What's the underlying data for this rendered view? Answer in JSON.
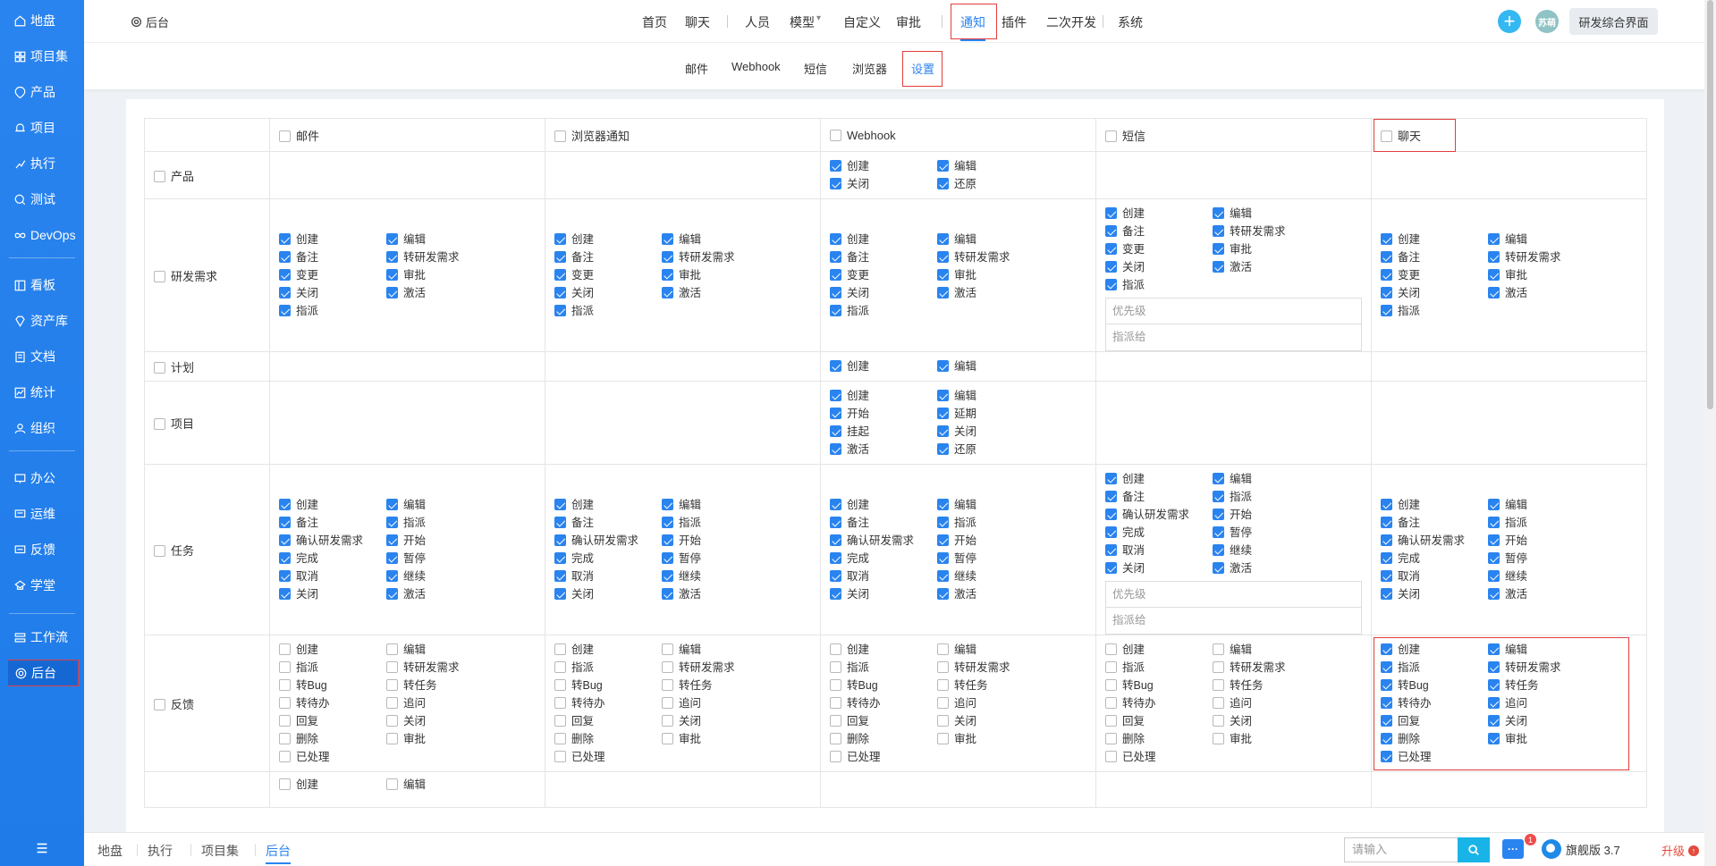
{
  "sidebar": {
    "items": [
      {
        "label": "地盘",
        "icon": "home-icon"
      },
      {
        "label": "项目集",
        "icon": "grid-icon"
      },
      {
        "label": "产品",
        "icon": "product-icon"
      },
      {
        "label": "项目",
        "icon": "bell-icon"
      },
      {
        "label": "执行",
        "icon": "run-icon"
      },
      {
        "label": "测试",
        "icon": "test-icon"
      },
      {
        "label": "DevOps",
        "icon": "infinity-icon"
      },
      {
        "label": "看板",
        "icon": "board-icon"
      },
      {
        "label": "资产库",
        "icon": "gem-icon"
      },
      {
        "label": "文档",
        "icon": "doc-icon"
      },
      {
        "label": "统计",
        "icon": "chart-icon"
      },
      {
        "label": "组织",
        "icon": "people-icon"
      },
      {
        "label": "办公",
        "icon": "office-icon"
      },
      {
        "label": "运维",
        "icon": "server-icon"
      },
      {
        "label": "反馈",
        "icon": "feedback-icon"
      },
      {
        "label": "学堂",
        "icon": "school-icon"
      },
      {
        "label": "工作流",
        "icon": "workflow-icon"
      },
      {
        "label": "后台",
        "icon": "gear-icon"
      }
    ]
  },
  "header": {
    "back_label": "后台",
    "nav": [
      "首页",
      "聊天",
      "人员",
      "模型",
      "自定义",
      "审批",
      "通知",
      "插件",
      "二次开发",
      "系统"
    ],
    "active_nav": "通知",
    "avatar_text": "苏萌",
    "space_label": "研发综合界面"
  },
  "subnav": {
    "items": [
      "邮件",
      "Webhook",
      "短信",
      "浏览器",
      "设置"
    ],
    "active": "设置"
  },
  "table": {
    "columns": [
      "邮件",
      "浏览器通知",
      "Webhook",
      "短信",
      "聊天"
    ],
    "select_placeholders": {
      "priority": "优先级",
      "assign": "指派给"
    },
    "rows": [
      {
        "label": "产品",
        "cells": [
          [],
          [],
          [
            {
              "t": "创建",
              "c": true
            },
            {
              "t": "编辑",
              "c": true
            },
            {
              "t": "关闭",
              "c": true
            },
            {
              "t": "还原",
              "c": true
            }
          ],
          [],
          []
        ]
      },
      {
        "label": "研发需求",
        "cells": [
          [
            {
              "t": "创建",
              "c": true
            },
            {
              "t": "编辑",
              "c": true
            },
            {
              "t": "备注",
              "c": true
            },
            {
              "t": "转研发需求",
              "c": true
            },
            {
              "t": "变更",
              "c": true
            },
            {
              "t": "审批",
              "c": true
            },
            {
              "t": "关闭",
              "c": true
            },
            {
              "t": "激活",
              "c": true
            },
            {
              "t": "指派",
              "c": true
            }
          ],
          [
            {
              "t": "创建",
              "c": true
            },
            {
              "t": "编辑",
              "c": true
            },
            {
              "t": "备注",
              "c": true
            },
            {
              "t": "转研发需求",
              "c": true
            },
            {
              "t": "变更",
              "c": true
            },
            {
              "t": "审批",
              "c": true
            },
            {
              "t": "关闭",
              "c": true
            },
            {
              "t": "激活",
              "c": true
            },
            {
              "t": "指派",
              "c": true
            }
          ],
          [
            {
              "t": "创建",
              "c": true
            },
            {
              "t": "编辑",
              "c": true
            },
            {
              "t": "备注",
              "c": true
            },
            {
              "t": "转研发需求",
              "c": true
            },
            {
              "t": "变更",
              "c": true
            },
            {
              "t": "审批",
              "c": true
            },
            {
              "t": "关闭",
              "c": true
            },
            {
              "t": "激活",
              "c": true
            },
            {
              "t": "指派",
              "c": true
            }
          ],
          [
            {
              "t": "创建",
              "c": true
            },
            {
              "t": "编辑",
              "c": true
            },
            {
              "t": "备注",
              "c": true
            },
            {
              "t": "转研发需求",
              "c": true
            },
            {
              "t": "变更",
              "c": true
            },
            {
              "t": "审批",
              "c": true
            },
            {
              "t": "关闭",
              "c": true
            },
            {
              "t": "激活",
              "c": true
            },
            {
              "t": "指派",
              "c": true
            }
          ],
          [
            {
              "t": "创建",
              "c": true
            },
            {
              "t": "编辑",
              "c": true
            },
            {
              "t": "备注",
              "c": true
            },
            {
              "t": "转研发需求",
              "c": true
            },
            {
              "t": "变更",
              "c": true
            },
            {
              "t": "审批",
              "c": true
            },
            {
              "t": "关闭",
              "c": true
            },
            {
              "t": "激活",
              "c": true
            },
            {
              "t": "指派",
              "c": true
            }
          ]
        ]
      },
      {
        "label": "计划",
        "cells": [
          [],
          [],
          [
            {
              "t": "创建",
              "c": true
            },
            {
              "t": "编辑",
              "c": true
            }
          ],
          [],
          []
        ]
      },
      {
        "label": "项目",
        "cells": [
          [],
          [],
          [
            {
              "t": "创建",
              "c": true
            },
            {
              "t": "编辑",
              "c": true
            },
            {
              "t": "开始",
              "c": true
            },
            {
              "t": "延期",
              "c": true
            },
            {
              "t": "挂起",
              "c": true
            },
            {
              "t": "关闭",
              "c": true
            },
            {
              "t": "激活",
              "c": true
            },
            {
              "t": "还原",
              "c": true
            }
          ],
          [],
          []
        ]
      },
      {
        "label": "任务",
        "cells": [
          [
            {
              "t": "创建",
              "c": true
            },
            {
              "t": "编辑",
              "c": true
            },
            {
              "t": "备注",
              "c": true
            },
            {
              "t": "指派",
              "c": true
            },
            {
              "t": "确认研发需求",
              "c": true
            },
            {
              "t": "开始",
              "c": true
            },
            {
              "t": "完成",
              "c": true
            },
            {
              "t": "暂停",
              "c": true
            },
            {
              "t": "取消",
              "c": true
            },
            {
              "t": "继续",
              "c": true
            },
            {
              "t": "关闭",
              "c": true
            },
            {
              "t": "激活",
              "c": true
            }
          ],
          [
            {
              "t": "创建",
              "c": true
            },
            {
              "t": "编辑",
              "c": true
            },
            {
              "t": "备注",
              "c": true
            },
            {
              "t": "指派",
              "c": true
            },
            {
              "t": "确认研发需求",
              "c": true
            },
            {
              "t": "开始",
              "c": true
            },
            {
              "t": "完成",
              "c": true
            },
            {
              "t": "暂停",
              "c": true
            },
            {
              "t": "取消",
              "c": true
            },
            {
              "t": "继续",
              "c": true
            },
            {
              "t": "关闭",
              "c": true
            },
            {
              "t": "激活",
              "c": true
            }
          ],
          [
            {
              "t": "创建",
              "c": true
            },
            {
              "t": "编辑",
              "c": true
            },
            {
              "t": "备注",
              "c": true
            },
            {
              "t": "指派",
              "c": true
            },
            {
              "t": "确认研发需求",
              "c": true
            },
            {
              "t": "开始",
              "c": true
            },
            {
              "t": "完成",
              "c": true
            },
            {
              "t": "暂停",
              "c": true
            },
            {
              "t": "取消",
              "c": true
            },
            {
              "t": "继续",
              "c": true
            },
            {
              "t": "关闭",
              "c": true
            },
            {
              "t": "激活",
              "c": true
            }
          ],
          [
            {
              "t": "创建",
              "c": true
            },
            {
              "t": "编辑",
              "c": true
            },
            {
              "t": "备注",
              "c": true
            },
            {
              "t": "指派",
              "c": true
            },
            {
              "t": "确认研发需求",
              "c": true
            },
            {
              "t": "开始",
              "c": true
            },
            {
              "t": "完成",
              "c": true
            },
            {
              "t": "暂停",
              "c": true
            },
            {
              "t": "取消",
              "c": true
            },
            {
              "t": "继续",
              "c": true
            },
            {
              "t": "关闭",
              "c": true
            },
            {
              "t": "激活",
              "c": true
            }
          ],
          [
            {
              "t": "创建",
              "c": true
            },
            {
              "t": "编辑",
              "c": true
            },
            {
              "t": "备注",
              "c": true
            },
            {
              "t": "指派",
              "c": true
            },
            {
              "t": "确认研发需求",
              "c": true
            },
            {
              "t": "开始",
              "c": true
            },
            {
              "t": "完成",
              "c": true
            },
            {
              "t": "暂停",
              "c": true
            },
            {
              "t": "取消",
              "c": true
            },
            {
              "t": "继续",
              "c": true
            },
            {
              "t": "关闭",
              "c": true
            },
            {
              "t": "激活",
              "c": true
            }
          ]
        ]
      },
      {
        "label": "反馈",
        "cells": [
          [
            {
              "t": "创建",
              "c": false
            },
            {
              "t": "编辑",
              "c": false
            },
            {
              "t": "指派",
              "c": false
            },
            {
              "t": "转研发需求",
              "c": false
            },
            {
              "t": "转Bug",
              "c": false
            },
            {
              "t": "转任务",
              "c": false
            },
            {
              "t": "转待办",
              "c": false
            },
            {
              "t": "追问",
              "c": false
            },
            {
              "t": "回复",
              "c": false
            },
            {
              "t": "关闭",
              "c": false
            },
            {
              "t": "删除",
              "c": false
            },
            {
              "t": "审批",
              "c": false
            },
            {
              "t": "已处理",
              "c": false
            }
          ],
          [
            {
              "t": "创建",
              "c": false
            },
            {
              "t": "编辑",
              "c": false
            },
            {
              "t": "指派",
              "c": false
            },
            {
              "t": "转研发需求",
              "c": false
            },
            {
              "t": "转Bug",
              "c": false
            },
            {
              "t": "转任务",
              "c": false
            },
            {
              "t": "转待办",
              "c": false
            },
            {
              "t": "追问",
              "c": false
            },
            {
              "t": "回复",
              "c": false
            },
            {
              "t": "关闭",
              "c": false
            },
            {
              "t": "删除",
              "c": false
            },
            {
              "t": "审批",
              "c": false
            },
            {
              "t": "已处理",
              "c": false
            }
          ],
          [
            {
              "t": "创建",
              "c": false
            },
            {
              "t": "编辑",
              "c": false
            },
            {
              "t": "指派",
              "c": false
            },
            {
              "t": "转研发需求",
              "c": false
            },
            {
              "t": "转Bug",
              "c": false
            },
            {
              "t": "转任务",
              "c": false
            },
            {
              "t": "转待办",
              "c": false
            },
            {
              "t": "追问",
              "c": false
            },
            {
              "t": "回复",
              "c": false
            },
            {
              "t": "关闭",
              "c": false
            },
            {
              "t": "删除",
              "c": false
            },
            {
              "t": "审批",
              "c": false
            },
            {
              "t": "已处理",
              "c": false
            }
          ],
          [
            {
              "t": "创建",
              "c": false
            },
            {
              "t": "编辑",
              "c": false
            },
            {
              "t": "指派",
              "c": false
            },
            {
              "t": "转研发需求",
              "c": false
            },
            {
              "t": "转Bug",
              "c": false
            },
            {
              "t": "转任务",
              "c": false
            },
            {
              "t": "转待办",
              "c": false
            },
            {
              "t": "追问",
              "c": false
            },
            {
              "t": "回复",
              "c": false
            },
            {
              "t": "关闭",
              "c": false
            },
            {
              "t": "删除",
              "c": false
            },
            {
              "t": "审批",
              "c": false
            },
            {
              "t": "已处理",
              "c": false
            }
          ],
          [
            {
              "t": "创建",
              "c": true
            },
            {
              "t": "编辑",
              "c": true
            },
            {
              "t": "指派",
              "c": true
            },
            {
              "t": "转研发需求",
              "c": true
            },
            {
              "t": "转Bug",
              "c": true
            },
            {
              "t": "转任务",
              "c": true
            },
            {
              "t": "转待办",
              "c": true
            },
            {
              "t": "追问",
              "c": true
            },
            {
              "t": "回复",
              "c": true
            },
            {
              "t": "关闭",
              "c": true
            },
            {
              "t": "删除",
              "c": true
            },
            {
              "t": "审批",
              "c": true
            },
            {
              "t": "已处理",
              "c": true
            }
          ]
        ]
      },
      {
        "label": "",
        "cells": [
          [
            {
              "t": "创建",
              "c": false
            },
            {
              "t": "编辑",
              "c": false
            }
          ],
          [],
          [],
          [],
          []
        ]
      }
    ]
  },
  "footer": {
    "tabs": [
      "地盘",
      "执行",
      "项目集",
      "后台"
    ],
    "active_tab": "后台",
    "search_placeholder": "请输入",
    "message_badge": "1",
    "edition": "旗舰版 3.7",
    "upgrade_label": "升级"
  },
  "colors": {
    "primary": "#2a84ef",
    "highlight": "#e23d3d",
    "accent": "#34b8f2"
  }
}
